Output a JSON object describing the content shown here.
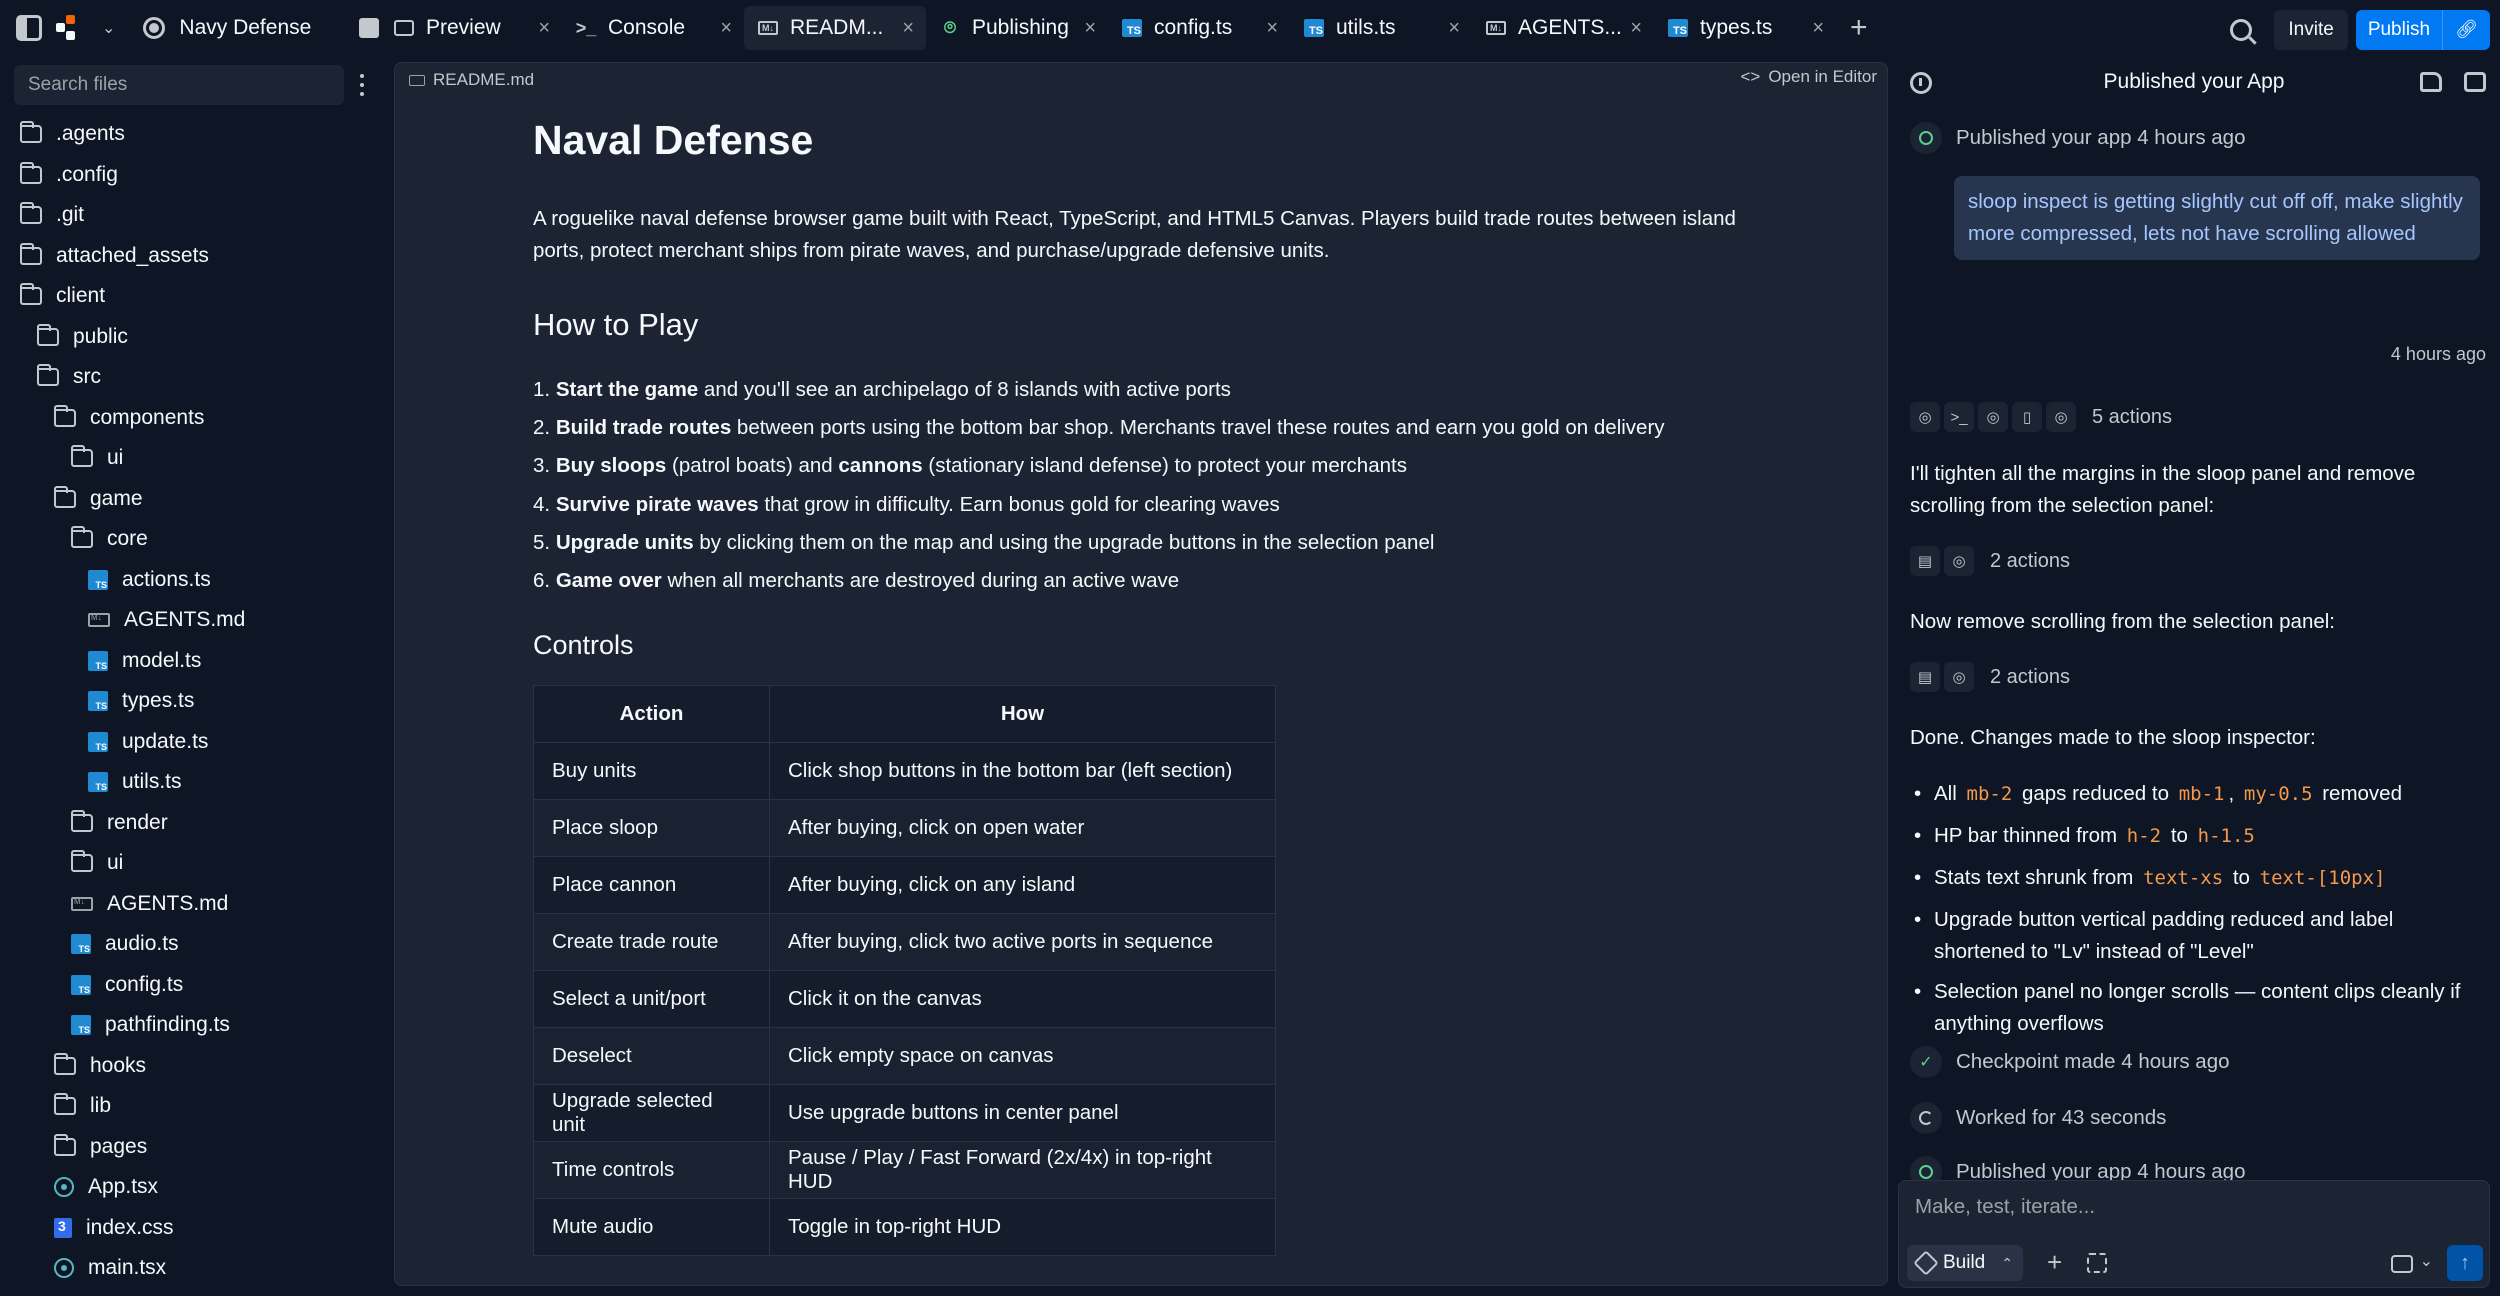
{
  "topbar": {
    "project_name": "Navy Defense",
    "tabs": [
      {
        "label": "Preview",
        "icon": "monitor-icon"
      },
      {
        "label": "Console",
        "icon": "terminal-icon"
      },
      {
        "label": "READM...",
        "icon": "markdown-icon"
      },
      {
        "label": "Publishing",
        "icon": "publish-icon"
      },
      {
        "label": "config.ts",
        "icon": "typescript-icon"
      },
      {
        "label": "utils.ts",
        "icon": "typescript-icon"
      },
      {
        "label": "AGENTS...",
        "icon": "markdown-icon"
      },
      {
        "label": "types.ts",
        "icon": "typescript-icon"
      }
    ],
    "invite_label": "Invite",
    "publish_label": "Publish"
  },
  "sidebar": {
    "search_placeholder": "Search files",
    "tree": [
      {
        "name": ".agents",
        "type": "folder",
        "depth": 0
      },
      {
        "name": ".config",
        "type": "folder",
        "depth": 0
      },
      {
        "name": ".git",
        "type": "folder",
        "depth": 0
      },
      {
        "name": "attached_assets",
        "type": "folder",
        "depth": 0
      },
      {
        "name": "client",
        "type": "folder-open",
        "depth": 0
      },
      {
        "name": "public",
        "type": "folder",
        "depth": 1
      },
      {
        "name": "src",
        "type": "folder-open",
        "depth": 1
      },
      {
        "name": "components",
        "type": "folder-open",
        "depth": 2
      },
      {
        "name": "ui",
        "type": "folder",
        "depth": 3
      },
      {
        "name": "game",
        "type": "folder-open",
        "depth": 2
      },
      {
        "name": "core",
        "type": "folder-open",
        "depth": 3
      },
      {
        "name": "actions.ts",
        "type": "ts",
        "depth": 4
      },
      {
        "name": "AGENTS.md",
        "type": "md",
        "depth": 4
      },
      {
        "name": "model.ts",
        "type": "ts",
        "depth": 4
      },
      {
        "name": "types.ts",
        "type": "ts",
        "depth": 4
      },
      {
        "name": "update.ts",
        "type": "ts",
        "depth": 4
      },
      {
        "name": "utils.ts",
        "type": "ts",
        "depth": 4
      },
      {
        "name": "render",
        "type": "folder",
        "depth": 3
      },
      {
        "name": "ui",
        "type": "folder",
        "depth": 3
      },
      {
        "name": "AGENTS.md",
        "type": "md",
        "depth": 3
      },
      {
        "name": "audio.ts",
        "type": "ts",
        "depth": 3
      },
      {
        "name": "config.ts",
        "type": "ts",
        "depth": 3
      },
      {
        "name": "pathfinding.ts",
        "type": "ts",
        "depth": 3
      },
      {
        "name": "hooks",
        "type": "folder",
        "depth": 2
      },
      {
        "name": "lib",
        "type": "folder",
        "depth": 2
      },
      {
        "name": "pages",
        "type": "folder",
        "depth": 2
      },
      {
        "name": "App.tsx",
        "type": "react",
        "depth": 2
      },
      {
        "name": "index.css",
        "type": "css",
        "depth": 2
      },
      {
        "name": "main.tsx",
        "type": "react",
        "depth": 2
      }
    ]
  },
  "editor": {
    "file_name": "README.md",
    "open_in_editor": "Open in Editor",
    "title": "Naval Defense",
    "intro": "A roguelike naval defense browser game built with React, TypeScript, and HTML5 Canvas. Players build trade routes between island ports, protect merchant ships from pirate waves, and purchase/upgrade defensive units.",
    "how_to_play_heading": "How to Play",
    "steps": [
      {
        "num": "1.",
        "parts": [
          {
            "b": "Start the game"
          },
          {
            "t": " and you'll see an archipelago of 8 islands with active ports"
          }
        ]
      },
      {
        "num": "2.",
        "parts": [
          {
            "b": "Build trade routes"
          },
          {
            "t": " between ports using the bottom bar shop. Merchants travel these routes and earn you gold on delivery"
          }
        ]
      },
      {
        "num": "3.",
        "parts": [
          {
            "b": "Buy sloops"
          },
          {
            "t": " (patrol boats) and "
          },
          {
            "b": "cannons"
          },
          {
            "t": " (stationary island defense) to protect your merchants"
          }
        ]
      },
      {
        "num": "4.",
        "parts": [
          {
            "b": "Survive pirate waves"
          },
          {
            "t": " that grow in difficulty. Earn bonus gold for clearing waves"
          }
        ]
      },
      {
        "num": "5.",
        "parts": [
          {
            "b": "Upgrade units"
          },
          {
            "t": " by clicking them on the map and using the upgrade buttons in the selection panel"
          }
        ]
      },
      {
        "num": "6.",
        "parts": [
          {
            "b": "Game over"
          },
          {
            "t": " when all merchants are destroyed during an active wave"
          }
        ]
      }
    ],
    "controls_heading": "Controls",
    "table_headers": [
      "Action",
      "How"
    ],
    "table_rows": [
      [
        "Buy units",
        "Click shop buttons in the bottom bar (left section)"
      ],
      [
        "Place sloop",
        "After buying, click on open water"
      ],
      [
        "Place cannon",
        "After buying, click on any island"
      ],
      [
        "Create trade route",
        "After buying, click two active ports in sequence"
      ],
      [
        "Select a unit/port",
        "Click it on the canvas"
      ],
      [
        "Deselect",
        "Click empty space on canvas"
      ],
      [
        "Upgrade selected unit",
        "Use upgrade buttons in center panel"
      ],
      [
        "Time controls",
        "Pause / Play / Fast Forward (2x/4x) in top-right HUD"
      ],
      [
        "Mute audio",
        "Toggle in top-right HUD"
      ]
    ]
  },
  "chat": {
    "title": "Published your App",
    "published_1": "Published your app 4 hours ago",
    "user_message": "sloop inspect is getting slightly cut off off, make slightly more compressed, lets not have scrolling allowed",
    "user_time": "4 hours ago",
    "actions_1": "5 actions",
    "msg_1": "I'll tighten all the margins in the sloop panel and remove scrolling from the selection panel:",
    "actions_2": "2 actions",
    "msg_2": "Now remove scrolling from the selection panel:",
    "actions_3": "2 actions",
    "msg_3": "Done. Changes made to the sloop inspector:",
    "bullets": {
      "b1_pre": "All",
      "b1_c1": "mb-2",
      "b1_mid": "gaps reduced to",
      "b1_c2": "mb-1",
      "b1_sep": ",",
      "b1_c3": "my-0.5",
      "b1_post": "removed",
      "b2_pre": "HP bar thinned from",
      "b2_c1": "h-2",
      "b2_mid": "to",
      "b2_c2": "h-1.5",
      "b3_pre": "Stats text shrunk from",
      "b3_c1": "text-xs",
      "b3_mid": "to",
      "b3_c2": "text-[10px]",
      "b4": "Upgrade button vertical padding reduced and label shortened to \"Lv\" instead of \"Level\"",
      "b5": "Selection panel no longer scrolls — content clips cleanly if anything overflows"
    },
    "checkpoint": "Checkpoint made 4 hours ago",
    "worked": "Worked for 43 seconds",
    "published_2": "Published your app 4 hours ago",
    "input_placeholder": "Make, test, iterate...",
    "build_label": "Build"
  }
}
